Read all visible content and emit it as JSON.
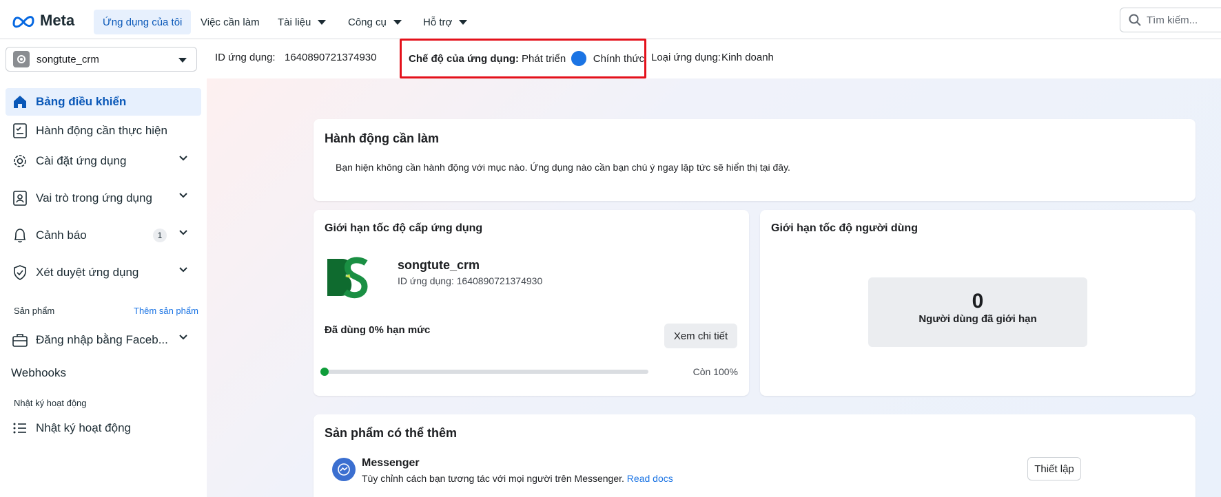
{
  "topnav": {
    "logo_text": "Meta",
    "items": [
      {
        "label": "Ứng dụng của tôi"
      },
      {
        "label": "Việc cần làm"
      },
      {
        "label": "Tài liệu"
      },
      {
        "label": "Công cụ"
      },
      {
        "label": "Hỗ trợ"
      }
    ],
    "search_placeholder": "Tìm kiếm..."
  },
  "subheader": {
    "app_name": "songtute_crm",
    "app_id_label": "ID ứng dụng:",
    "app_id_value": "1640890721374930",
    "mode_label": "Chế độ của ứng dụng:",
    "mode_dev": "Phát triển",
    "mode_live": "Chính thức",
    "app_type_label": "Loại ứng dụng:",
    "app_type_value": "Kinh doanh"
  },
  "sidebar": {
    "items": [
      {
        "label": "Bảng điều khiển"
      },
      {
        "label": "Hành động cần thực hiện"
      },
      {
        "label": "Cài đặt ứng dụng"
      },
      {
        "label": "Vai trò trong ứng dụng"
      },
      {
        "label": "Cảnh báo",
        "badge": "1"
      },
      {
        "label": "Xét duyệt ứng dụng"
      },
      {
        "label": "Đăng nhập bằng Faceb..."
      }
    ],
    "products_label": "Sản phẩm",
    "add_product_link": "Thêm sản phẩm",
    "webhooks_label": "Webhooks",
    "activity_section_label": "Nhật ký hoạt động",
    "activity_item_label": "Nhật ký hoạt động"
  },
  "actions_card": {
    "title": "Hành động cần làm",
    "message": "Bạn hiện không cần hành động với mục nào. Ứng dụng nào cần bạn chú ý ngay lập tức sẽ hiển thị tại đây."
  },
  "rate_app_card": {
    "title": "Giới hạn tốc độ cấp ứng dụng",
    "app_name": "songtute_crm",
    "app_id_line": "ID ứng dụng: 1640890721374930",
    "usage_label": "Đã dùng 0% hạn mức",
    "detail_button": "Xem chi tiết",
    "usage_fraction": 0,
    "remaining_label": "Còn 100%"
  },
  "rate_user_card": {
    "title": "Giới hạn tốc độ người dùng",
    "count": "0",
    "count_label": "Người dùng đã giới hạn"
  },
  "products_card": {
    "title": "Sản phẩm có thể thêm",
    "product_name": "Messenger",
    "product_desc": "Tùy chỉnh cách bạn tương tác với mọi người trên Messenger.",
    "read_docs": "Read docs",
    "setup_button": "Thiết lập"
  },
  "colors": {
    "accent": "#1b74e4",
    "highlight_border": "#e4111b",
    "progress_dot": "#0f9d3a"
  }
}
